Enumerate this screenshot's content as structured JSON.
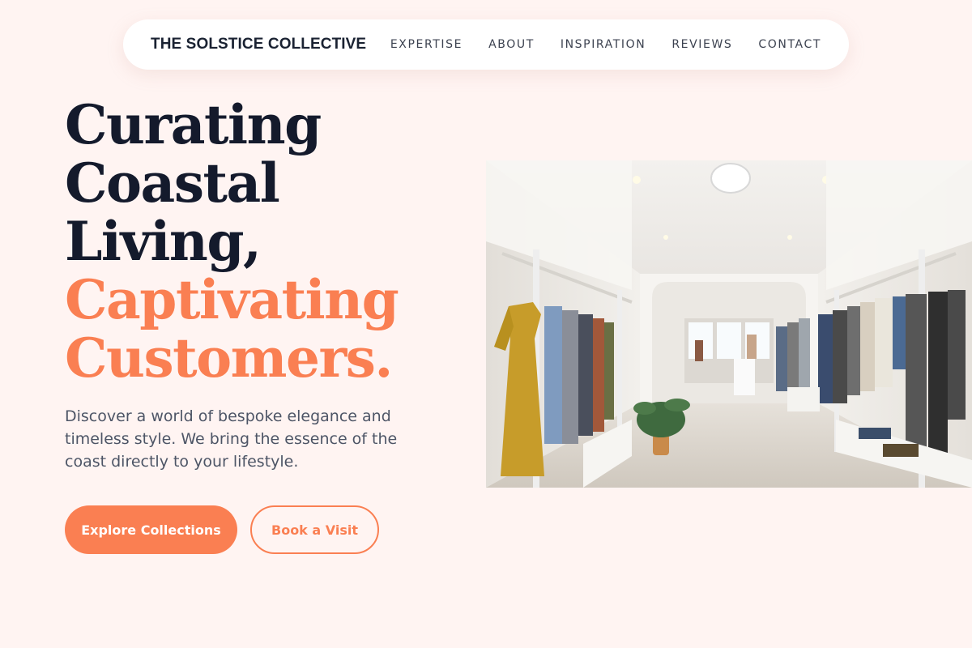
{
  "nav": {
    "brand": "THE SOLSTICE COLLECTIVE",
    "links": [
      "EXPERTISE",
      "ABOUT",
      "INSPIRATION",
      "REVIEWS",
      "CONTACT"
    ]
  },
  "hero": {
    "headline_dark": [
      "Curating",
      "Coastal",
      "Living,"
    ],
    "headline_accent": [
      "Captivating",
      "Customers."
    ],
    "lede": "Discover a world of bespoke elegance and timeless style. We bring the essence of the coast directly to your lifestyle.",
    "primary_cta": "Explore Collections",
    "secondary_cta": "Book a Visit",
    "image_subject": "clothing-boutique-interior-photo"
  },
  "colors": {
    "background": "#fff4f2",
    "accent": "#fa7f52",
    "heading_dark": "#141a2c",
    "body_text": "#4d5566"
  }
}
